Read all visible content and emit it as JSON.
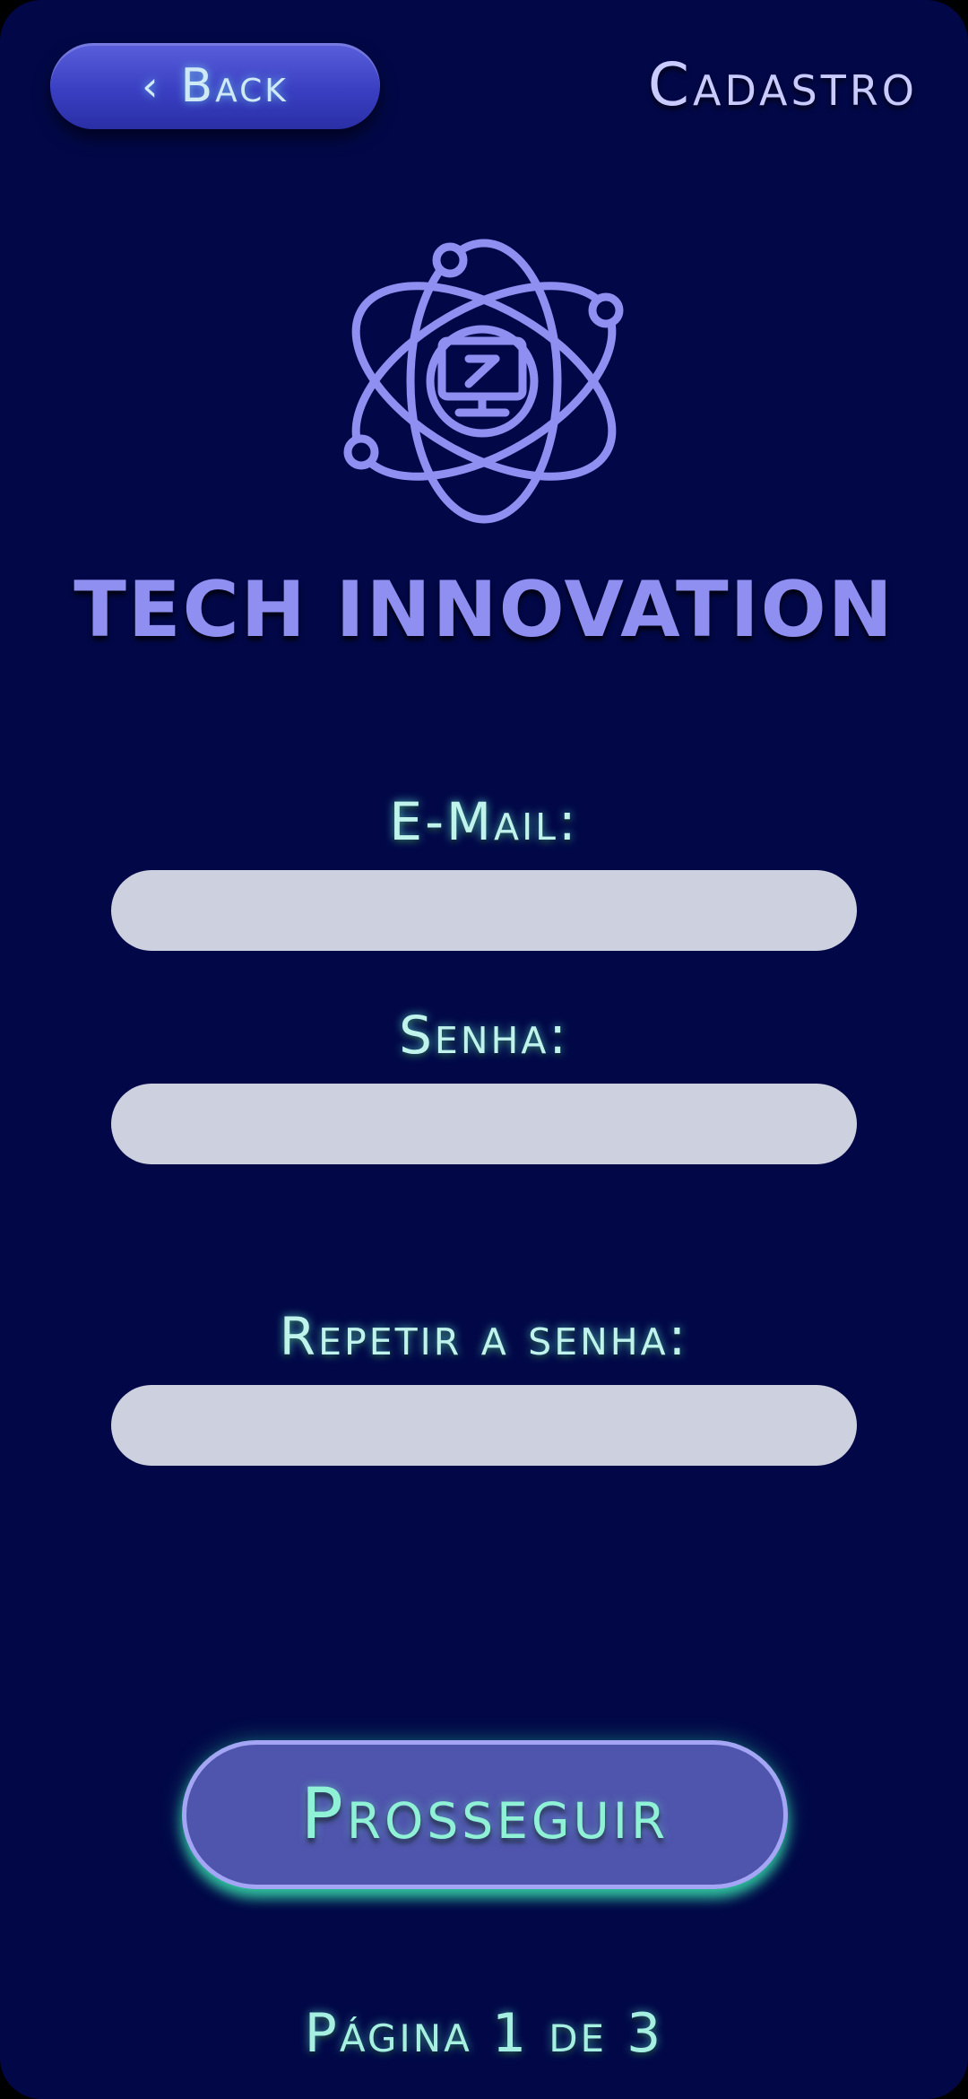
{
  "header": {
    "back_label": "Back",
    "back_icon": "chevron-left-icon",
    "title": "Cadastro"
  },
  "brand": {
    "logo_icon": "atom-computer-icon",
    "name": "TECH INNOVATION"
  },
  "form": {
    "email_label": "E-Mail:",
    "email_value": "",
    "password_label": "Senha:",
    "password_value": "",
    "repeat_password_label": "Repetir a senha:",
    "repeat_password_value": ""
  },
  "actions": {
    "proceed_label": "Prosseguir"
  },
  "footer": {
    "page_indicator": "Página 1 de 3"
  },
  "colors": {
    "background": "#020847",
    "accent": "#8f8ff2",
    "label_glow": "#bff3ec",
    "field": "#cdd0de",
    "button": "#4f55ad"
  }
}
